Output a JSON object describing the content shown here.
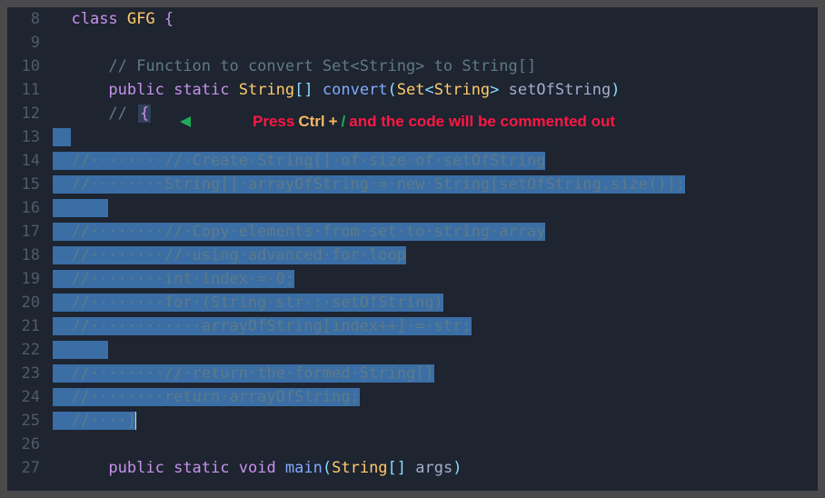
{
  "lines": [
    {
      "num": 8,
      "tokens": [
        [
          "tk-keyword",
          "class "
        ],
        [
          "tk-type",
          "GFG "
        ],
        [
          "tk-brace",
          "{"
        ]
      ],
      "indent": "  "
    },
    {
      "num": 9,
      "tokens": [],
      "indent": ""
    },
    {
      "num": 10,
      "tokens": [
        [
          "tk-comment",
          "// Function to convert Set<String> to String[]"
        ]
      ],
      "indent": "      "
    },
    {
      "num": 11,
      "tokens": [
        [
          "tk-keyword",
          "public "
        ],
        [
          "tk-keyword",
          "static "
        ],
        [
          "tk-type",
          "String"
        ],
        [
          "tk-punct",
          "[] "
        ],
        [
          "tk-func",
          "convert"
        ],
        [
          "tk-punct",
          "("
        ],
        [
          "tk-type",
          "Set"
        ],
        [
          "tk-punct",
          "<"
        ],
        [
          "tk-type",
          "String"
        ],
        [
          "tk-punct",
          "> "
        ],
        [
          "tk-default",
          "setOfString"
        ],
        [
          "tk-punct",
          ")"
        ]
      ],
      "indent": "      "
    },
    {
      "num": 12,
      "tokens": [],
      "indent": "      ",
      "raw12": true
    },
    {
      "num": 13,
      "sel": "  ",
      "indent": ""
    },
    {
      "num": 14,
      "sel": "  //········//·Create·String[]·of·size·of·setOfString",
      "indent": "",
      "cls": "tk-comment"
    },
    {
      "num": 15,
      "sel": "  //········String[]·arrayOfString·=·new·String[setOfString.size()];",
      "indent": "",
      "cls": "tk-comment"
    },
    {
      "num": 16,
      "sel": "      ",
      "indent": ""
    },
    {
      "num": 17,
      "sel": "  //········//·Copy·elements·from·set·to·string·array",
      "indent": "",
      "cls": "tk-comment"
    },
    {
      "num": 18,
      "sel": "  //········//·using·advanced·for·loop",
      "indent": "",
      "cls": "tk-comment"
    },
    {
      "num": 19,
      "sel": "  //········int·index·=·0;",
      "indent": "",
      "cls": "tk-comment"
    },
    {
      "num": 20,
      "sel": "  //········for·(String·str·:·setOfString)",
      "indent": "",
      "cls": "tk-comment"
    },
    {
      "num": 21,
      "sel": "  //············arrayOfString[index++]·=·str;",
      "indent": "",
      "cls": "tk-comment"
    },
    {
      "num": 22,
      "sel": "      ",
      "indent": ""
    },
    {
      "num": 23,
      "sel": "  //········//·return·the·formed·String[]",
      "indent": "",
      "cls": "tk-comment"
    },
    {
      "num": 24,
      "sel": "  //········return·arrayOfString;",
      "indent": "",
      "cls": "tk-comment"
    },
    {
      "num": 25,
      "sel": "  //····}",
      "indent": "",
      "cls": "tk-comment",
      "caret": true
    },
    {
      "num": 26,
      "tokens": [],
      "indent": ""
    },
    {
      "num": 27,
      "tokens": [
        [
          "tk-keyword",
          "public "
        ],
        [
          "tk-keyword",
          "static "
        ],
        [
          "tk-keyword",
          "void "
        ],
        [
          "tk-func",
          "main"
        ],
        [
          "tk-punct",
          "("
        ],
        [
          "tk-type",
          "String"
        ],
        [
          "tk-punct",
          "[] "
        ],
        [
          "tk-default",
          "args"
        ],
        [
          "tk-punct",
          ")"
        ]
      ],
      "indent": "      "
    }
  ],
  "line12": {
    "prefix": "// ",
    "brace": "{"
  },
  "annotation": {
    "press": "Press",
    "ctrl": "Ctrl",
    "plus": "+",
    "slash": "/",
    "rest": "and the code will be commented out"
  }
}
